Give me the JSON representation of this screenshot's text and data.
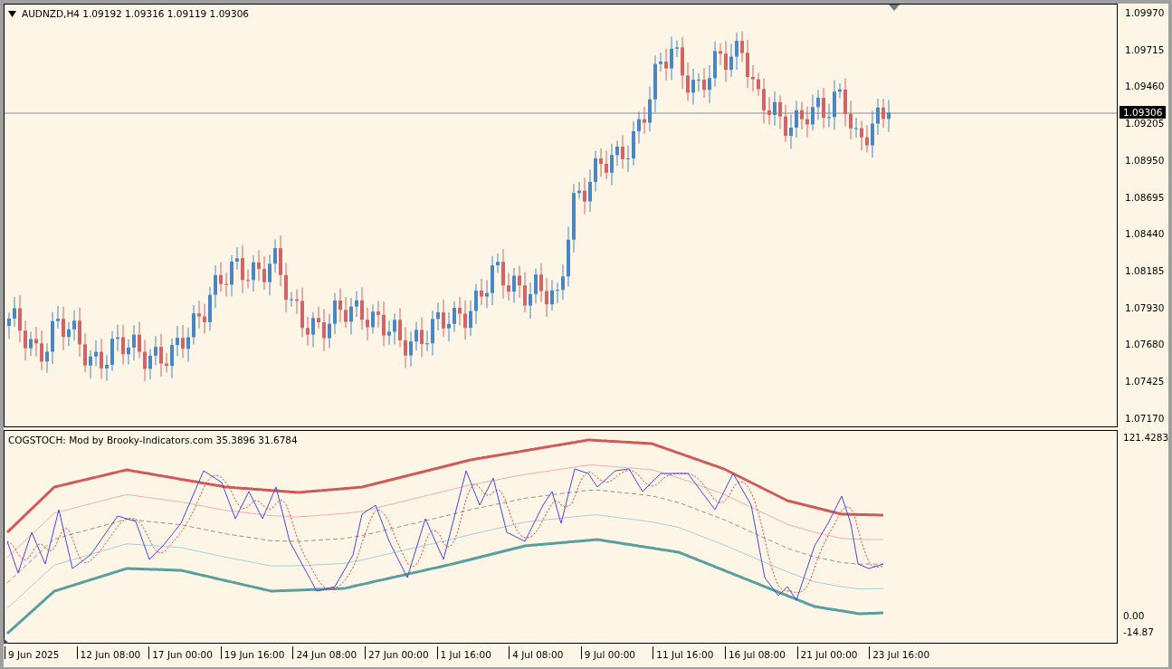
{
  "main_chart": {
    "header": "AUDNZD,H4  1.09192 1.09316 1.09119 1.09306"
  },
  "price_axis": {
    "ticks": [
      "1.09970",
      "1.09715",
      "1.09460",
      "1.09205",
      "1.08950",
      "1.08695",
      "1.08440",
      "1.08185",
      "1.07930",
      "1.07680",
      "1.07425",
      "1.07170"
    ],
    "current_price": "1.09306"
  },
  "indicator_chart": {
    "header": "COGSTOCH: Mod by Brooky-Indicators.com 35.3896 31.6784"
  },
  "indicator_axis": {
    "ticks": [
      "121.4283",
      "0.00",
      "-14.87"
    ]
  },
  "time_axis": {
    "labels": [
      "9 Jun 2025",
      "12 Jun 08:00",
      "17 Jun 00:00",
      "19 Jun 16:00",
      "24 Jun 08:00",
      "27 Jun 00:00",
      "1 Jul 16:00",
      "4 Jul 08:00",
      "9 Jul 00:00",
      "11 Jul 16:00",
      "16 Jul 08:00",
      "21 Jul 00:00",
      "23 Jul 16:00"
    ]
  }
}
